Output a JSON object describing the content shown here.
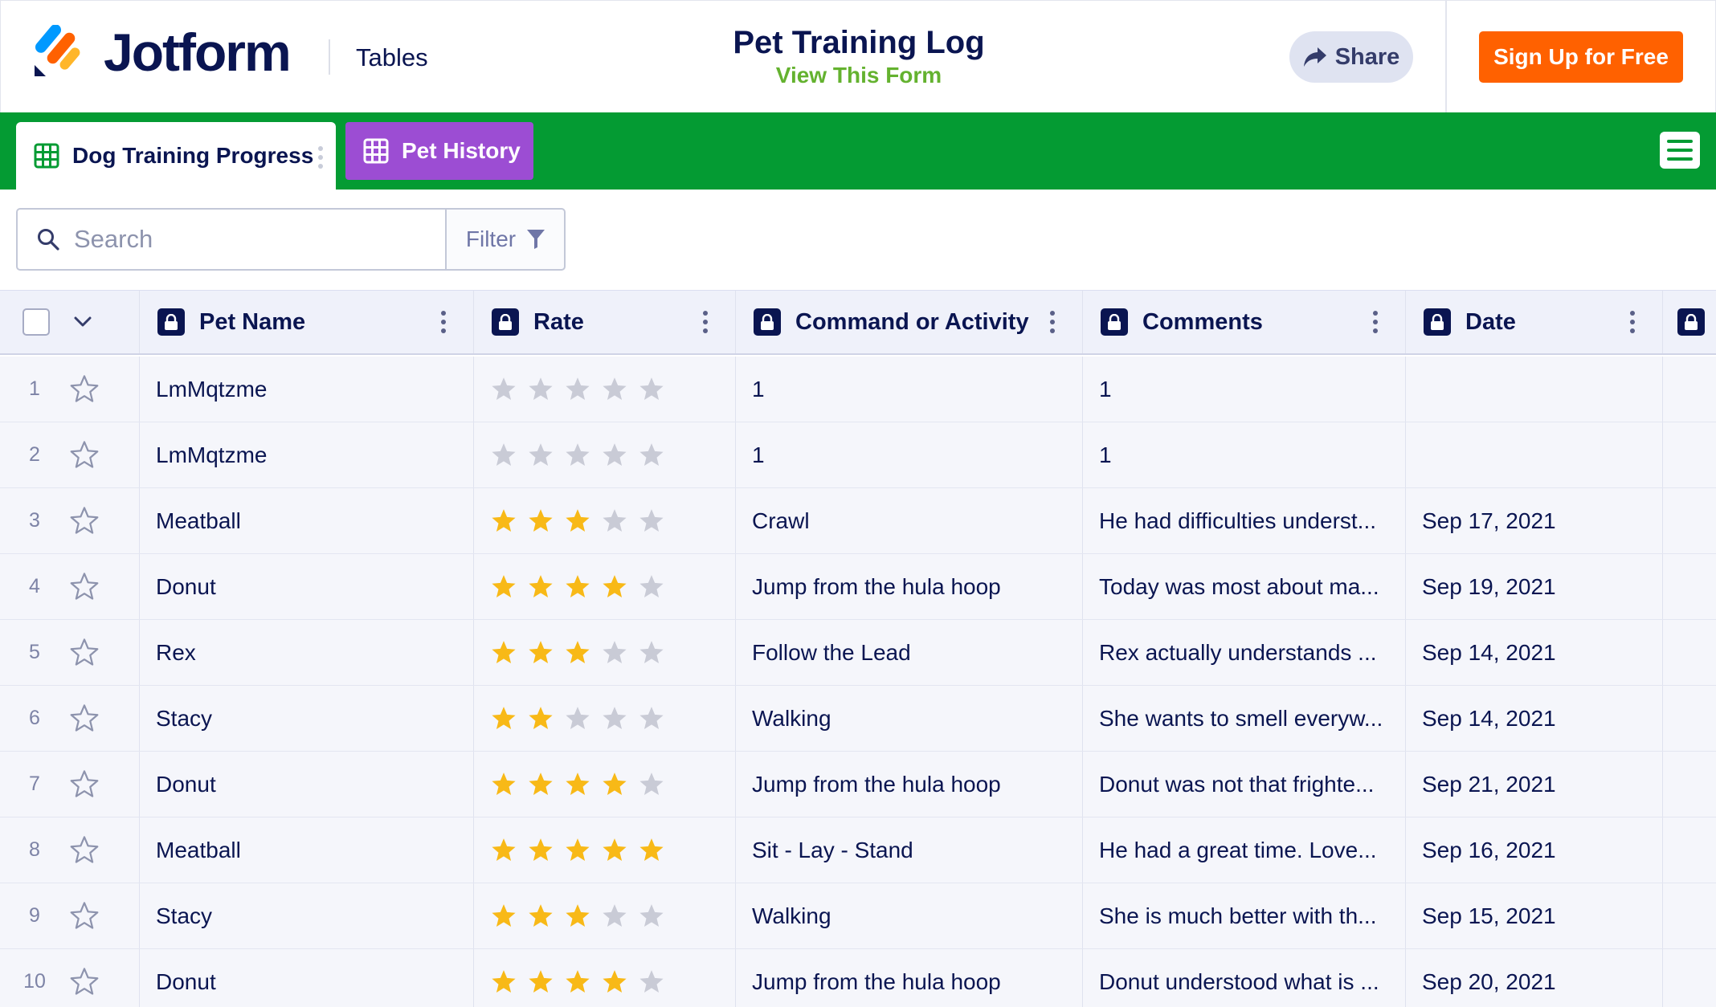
{
  "header": {
    "brand": "Jotform",
    "section": "Tables",
    "title": "Pet Training Log",
    "view_form": "View This Form",
    "share": "Share",
    "signup": "Sign Up for Free"
  },
  "tabs": [
    {
      "label": "Dog Training Progress",
      "active": true
    },
    {
      "label": "Pet History",
      "active": false
    }
  ],
  "search": {
    "placeholder": "Search",
    "filter": "Filter"
  },
  "columns": [
    "Pet Name",
    "Rate",
    "Command or Activity",
    "Comments",
    "Date"
  ],
  "rating_max": 5,
  "colors": {
    "star_filled": "#f8b917",
    "star_empty": "#c9cbd6",
    "tabbar": "#049b33",
    "tab_purple": "#9c4dd3",
    "signup": "#ff6100"
  },
  "rows": [
    {
      "n": "1",
      "pet": "LmMqtzme",
      "rating": 0,
      "command": "1",
      "comments": "1",
      "date": ""
    },
    {
      "n": "2",
      "pet": "LmMqtzme",
      "rating": 0,
      "command": "1",
      "comments": "1",
      "date": ""
    },
    {
      "n": "3",
      "pet": "Meatball",
      "rating": 3,
      "command": "Crawl",
      "comments": "He had difficulties underst...",
      "date": "Sep 17, 2021"
    },
    {
      "n": "4",
      "pet": "Donut",
      "rating": 4,
      "command": "Jump from the hula hoop",
      "comments": "Today was most about ma...",
      "date": "Sep 19, 2021"
    },
    {
      "n": "5",
      "pet": "Rex",
      "rating": 3,
      "command": "Follow the Lead",
      "comments": "Rex actually understands ...",
      "date": "Sep 14, 2021"
    },
    {
      "n": "6",
      "pet": "Stacy",
      "rating": 2,
      "command": "Walking",
      "comments": "She wants to smell everyw...",
      "date": "Sep 14, 2021"
    },
    {
      "n": "7",
      "pet": "Donut",
      "rating": 4,
      "command": "Jump from the hula hoop",
      "comments": "Donut was not that frighte...",
      "date": "Sep 21, 2021"
    },
    {
      "n": "8",
      "pet": "Meatball",
      "rating": 5,
      "command": "Sit - Lay - Stand",
      "comments": "He had a great time. Love...",
      "date": "Sep 16, 2021"
    },
    {
      "n": "9",
      "pet": "Stacy",
      "rating": 3,
      "command": "Walking",
      "comments": "She is much better with th...",
      "date": "Sep 15, 2021"
    },
    {
      "n": "10",
      "pet": "Donut",
      "rating": 4,
      "command": "Jump from the hula hoop",
      "comments": "Donut understood what is ...",
      "date": "Sep 20, 2021"
    }
  ]
}
